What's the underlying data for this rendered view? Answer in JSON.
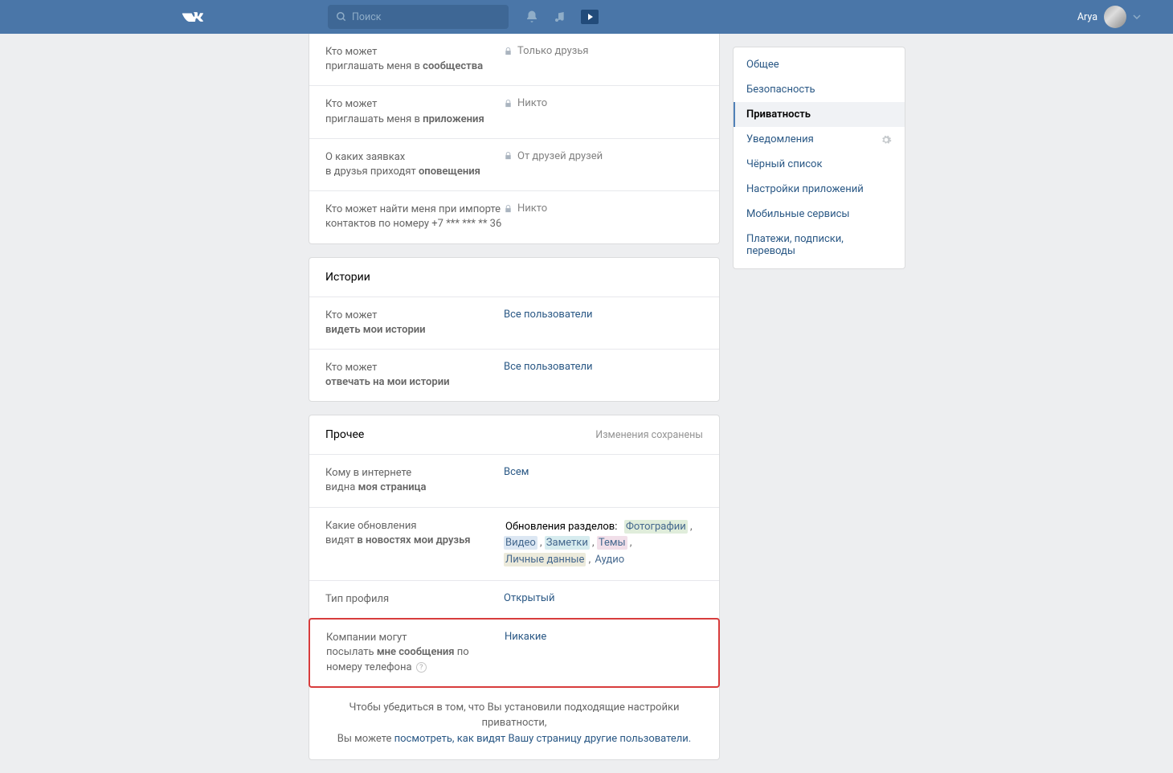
{
  "header": {
    "logo": "W",
    "search_placeholder": "Поиск",
    "username": "Arya"
  },
  "sidebar": {
    "items": [
      {
        "label": "Общее"
      },
      {
        "label": "Безопасность"
      },
      {
        "label": "Приватность"
      },
      {
        "label": "Уведомления"
      },
      {
        "label": "Чёрный список"
      },
      {
        "label": "Настройки приложений"
      },
      {
        "label": "Мобильные сервисы"
      },
      {
        "label": "Платежи, подписки, переводы"
      }
    ]
  },
  "section_top": {
    "rows": [
      {
        "label_pre": "Кто может",
        "label_mid": "приглашать меня в ",
        "label_bold": "сообщества",
        "value": "Только друзья",
        "locked": true
      },
      {
        "label_pre": "Кто может",
        "label_mid": "приглашать меня в ",
        "label_bold": "приложения",
        "value": "Никто",
        "locked": true
      },
      {
        "label_pre": "О каких заявках",
        "label_mid": "в друзья приходят ",
        "label_bold": "оповещения",
        "value": "От друзей друзей",
        "locked": true
      },
      {
        "label_pre": "Кто может найти меня при импорте",
        "label_mid": "контактов по номеру +7 *** *** ** 36",
        "label_bold": "",
        "value": "Никто",
        "locked": true
      }
    ]
  },
  "section_stories": {
    "title": "Истории",
    "rows": [
      {
        "label_pre": "Кто может",
        "label_bold": "видеть мои истории",
        "value": "Все пользователи"
      },
      {
        "label_pre": "Кто может",
        "label_bold": "отвечать на мои истории",
        "value": "Все пользователи"
      }
    ]
  },
  "section_other": {
    "title": "Прочее",
    "status": "Изменения сохранены",
    "rows": [
      {
        "label_pre": "Кому в интернете",
        "label_mid": "видна ",
        "label_bold": "моя страница",
        "value": "Всем"
      },
      {
        "label_pre": "Какие обновления",
        "label_mid": "видят ",
        "label_bold": "в новостях мои друзья",
        "updates_intro": "Обновления разделов:",
        "tags": {
          "photo": "Фотографии",
          "video": "Видео",
          "notes": "Заметки",
          "topics": "Темы",
          "personal": "Личные данные",
          "audio": "Аудио"
        }
      },
      {
        "label_pre": "Тип профиля",
        "label_mid": "",
        "label_bold": "",
        "value": "Открытый"
      },
      {
        "label_pre": "Компании могут",
        "label_mid": "посылать ",
        "label_bold": "мне сообщения",
        "label_post": " по номеру телефона",
        "value": "Никакие",
        "highlighted": true
      }
    ]
  },
  "footer": {
    "line1": "Чтобы убедиться в том, что Вы установили подходящие настройки приватности,",
    "line2_pre": "Вы можете ",
    "line2_link": "посмотреть, как видят Вашу страницу другие пользователи."
  }
}
